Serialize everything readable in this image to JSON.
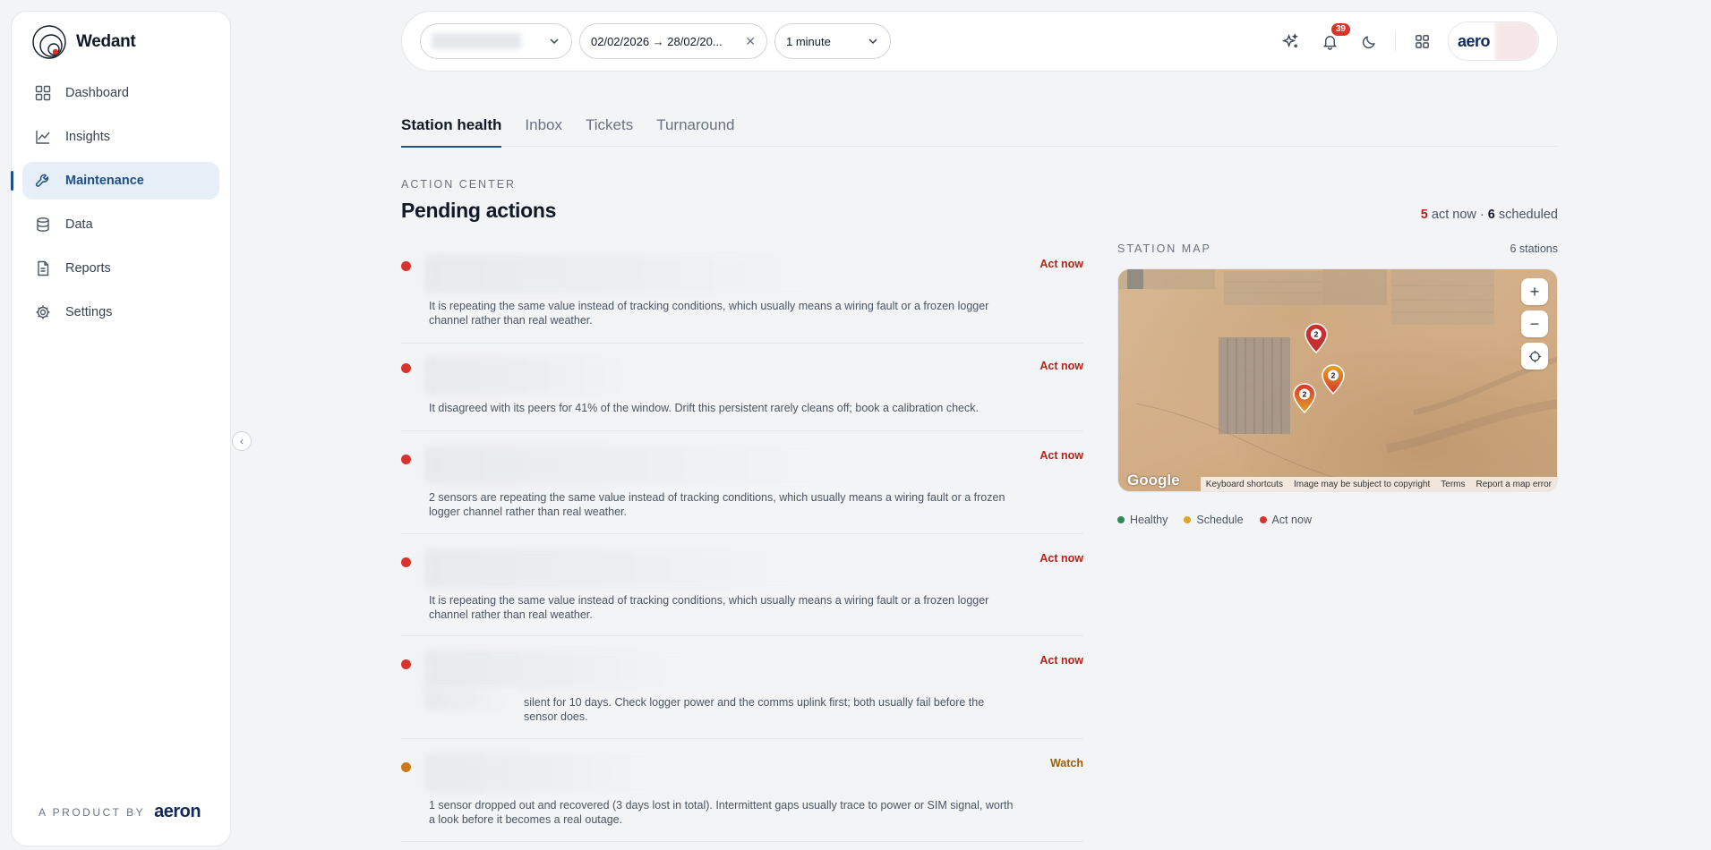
{
  "brand": {
    "name": "Wedant"
  },
  "sidebar": {
    "items": [
      {
        "label": "Dashboard",
        "icon": "grid-icon"
      },
      {
        "label": "Insights",
        "icon": "line-chart-icon"
      },
      {
        "label": "Maintenance",
        "icon": "wrench-icon",
        "active": true
      },
      {
        "label": "Data",
        "icon": "database-icon"
      },
      {
        "label": "Reports",
        "icon": "document-icon"
      },
      {
        "label": "Settings",
        "icon": "gear-icon"
      }
    ],
    "footer_label": "A PRODUCT BY",
    "footer_brand": "aeron"
  },
  "topbar": {
    "date_range": "02/02/2026 → 28/02/20...",
    "interval": "1 minute",
    "notifications_count": "39",
    "account_name": "aero"
  },
  "tabs": [
    {
      "label": "Station health",
      "active": true
    },
    {
      "label": "Inbox"
    },
    {
      "label": "Tickets"
    },
    {
      "label": "Turnaround"
    }
  ],
  "action_center": {
    "eyebrow": "ACTION CENTER",
    "title": "Pending actions",
    "summary": {
      "act_now_count": "5",
      "act_now_label": "act now ·",
      "scheduled_count": "6",
      "scheduled_label": "scheduled"
    },
    "actions": [
      {
        "severity": "red",
        "status": "Act now",
        "description": "It is repeating the same value instead of tracking conditions, which usually means a wiring fault or a frozen logger channel rather than real weather."
      },
      {
        "severity": "red",
        "status": "Act now",
        "description": "It disagreed with its peers for 41% of the window. Drift this persistent rarely cleans off; book a calibration check."
      },
      {
        "severity": "red",
        "status": "Act now",
        "description": "2 sensors are repeating the same value instead of tracking conditions, which usually means a wiring fault or a frozen logger channel rather than real weather."
      },
      {
        "severity": "red",
        "status": "Act now",
        "description": "It is repeating the same value instead of tracking conditions, which usually means a wiring fault or a frozen logger channel rather than real weather."
      },
      {
        "severity": "red",
        "status": "Act now",
        "description": "silent for 10 days. Check logger power and the comms uplink first; both usually fail before the sensor does."
      },
      {
        "severity": "amber",
        "status": "Watch",
        "description": "1 sensor dropped out and recovered (3 days lost in total). Intermittent gaps usually trace to power or SIM signal, worth a look before it becomes a real outage."
      }
    ]
  },
  "station_map": {
    "eyebrow": "STATION MAP",
    "count": "6 stations",
    "markers": [
      {
        "count": "2",
        "color": "#c62f2f"
      },
      {
        "count": "2",
        "color": "#d9342b"
      },
      {
        "count": "2",
        "color": "#e0a526"
      }
    ],
    "attribution": {
      "logo": "Google",
      "shortcuts": "Keyboard shortcuts",
      "copyright": "Image may be subject to copyright",
      "terms": "Terms",
      "report": "Report a map error"
    },
    "legend": [
      {
        "label": "Healthy",
        "color": "#2e8a57"
      },
      {
        "label": "Schedule",
        "color": "#e0a526"
      },
      {
        "label": "Act now",
        "color": "#d9342b"
      }
    ]
  }
}
